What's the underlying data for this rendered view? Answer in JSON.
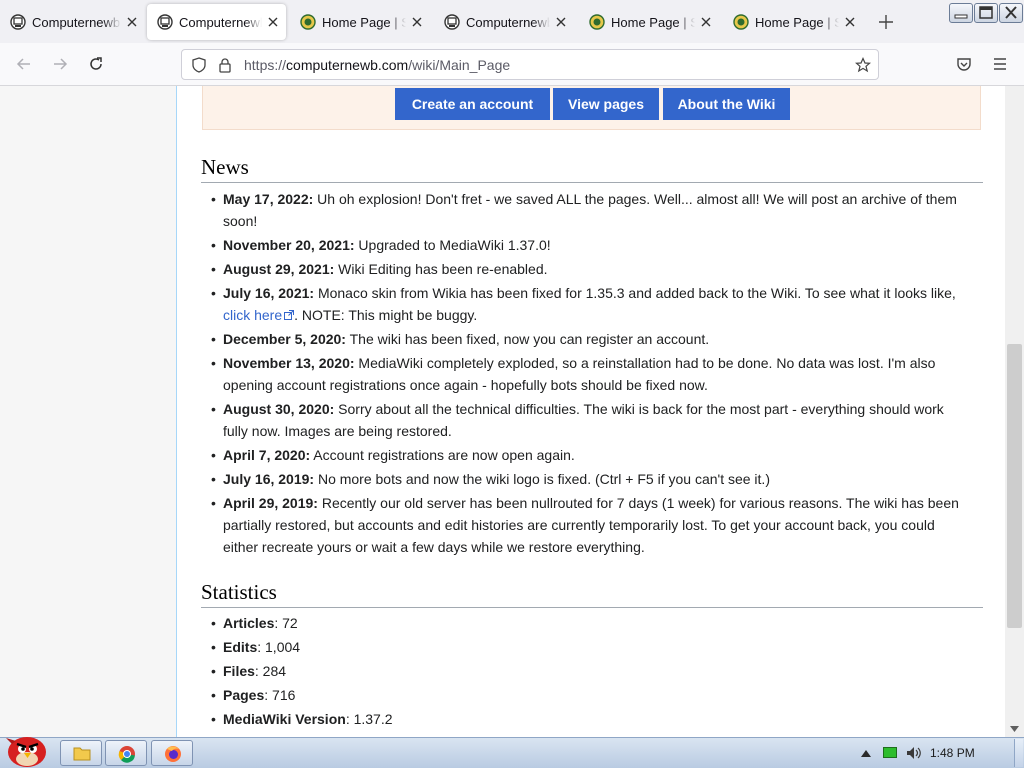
{
  "browser": {
    "tabs": [
      {
        "title": "Computernewb",
        "active": false,
        "favicon": "computer-icon"
      },
      {
        "title": "Computernewb",
        "active": true,
        "favicon": "computer-icon"
      },
      {
        "title": "Home Page | Se",
        "active": false,
        "favicon": "shield-icon"
      },
      {
        "title": "Computernewb",
        "active": false,
        "favicon": "computer-icon"
      },
      {
        "title": "Home Page | Se",
        "active": false,
        "favicon": "shield-icon"
      },
      {
        "title": "Home Page | Se",
        "active": false,
        "favicon": "shield-icon"
      }
    ],
    "url_prefix": "https://",
    "url_domain": "computernewb.com",
    "url_path": "/wiki/Main_Page"
  },
  "banner": {
    "buttons": [
      {
        "label": "Create an account"
      },
      {
        "label": "View pages"
      },
      {
        "label": "About the Wiki"
      }
    ]
  },
  "news": {
    "heading": "News",
    "items": [
      {
        "date": "May 17, 2022:",
        "text": " Uh oh explosion! Don't fret - we saved ALL the pages. Well... almost all! We will post an archive of them soon!"
      },
      {
        "date": "November 20, 2021:",
        "text": " Upgraded to MediaWiki 1.37.0!"
      },
      {
        "date": "August 29, 2021:",
        "text": " Wiki Editing has been re-enabled."
      },
      {
        "date": "July 16, 2021:",
        "text": " Monaco skin from Wikia has been fixed for 1.35.3 and added back to the Wiki. To see what it looks like, ",
        "link": "click here",
        "after": ". NOTE: This might be buggy."
      },
      {
        "date": "December 5, 2020:",
        "text": " The wiki has been fixed, now you can register an account."
      },
      {
        "date": "November 13, 2020:",
        "text": " MediaWiki completely exploded, so a reinstallation had to be done. No data was lost. I'm also opening account registrations once again - hopefully bots should be fixed now."
      },
      {
        "date": "August 30, 2020:",
        "text": " Sorry about all the technical difficulties. The wiki is back for the most part - everything should work fully now. Images are being restored."
      },
      {
        "date": "April 7, 2020:",
        "text": " Account registrations are now open again."
      },
      {
        "date": "July 16, 2019:",
        "text": " No more bots and now the wiki logo is fixed. (Ctrl + F5 if you can't see it.)"
      },
      {
        "date": "April 29, 2019:",
        "text": " Recently our old server has been nullrouted for 7 days (1 week) for various reasons. The wiki has been partially restored, but accounts and edit histories are currently temporarily lost. To get your account back, you could either recreate yours or wait a few days while we restore everything."
      }
    ]
  },
  "statistics": {
    "heading": "Statistics",
    "items": [
      {
        "label": "Articles",
        "value": ": 72"
      },
      {
        "label": "Edits",
        "value": ": 1,004"
      },
      {
        "label": "Files",
        "value": ": 284"
      },
      {
        "label": "Pages",
        "value": ": 716"
      },
      {
        "label": "MediaWiki Version",
        "value": ": 1.37.2"
      }
    ]
  },
  "taskbar": {
    "clock": "1:48 PM",
    "apps": [
      "explorer-icon",
      "chrome-icon",
      "firefox-icon"
    ]
  },
  "colors": {
    "link": "#3366cc",
    "button": "#3366cc",
    "banner_bg": "#fdf2e9"
  }
}
